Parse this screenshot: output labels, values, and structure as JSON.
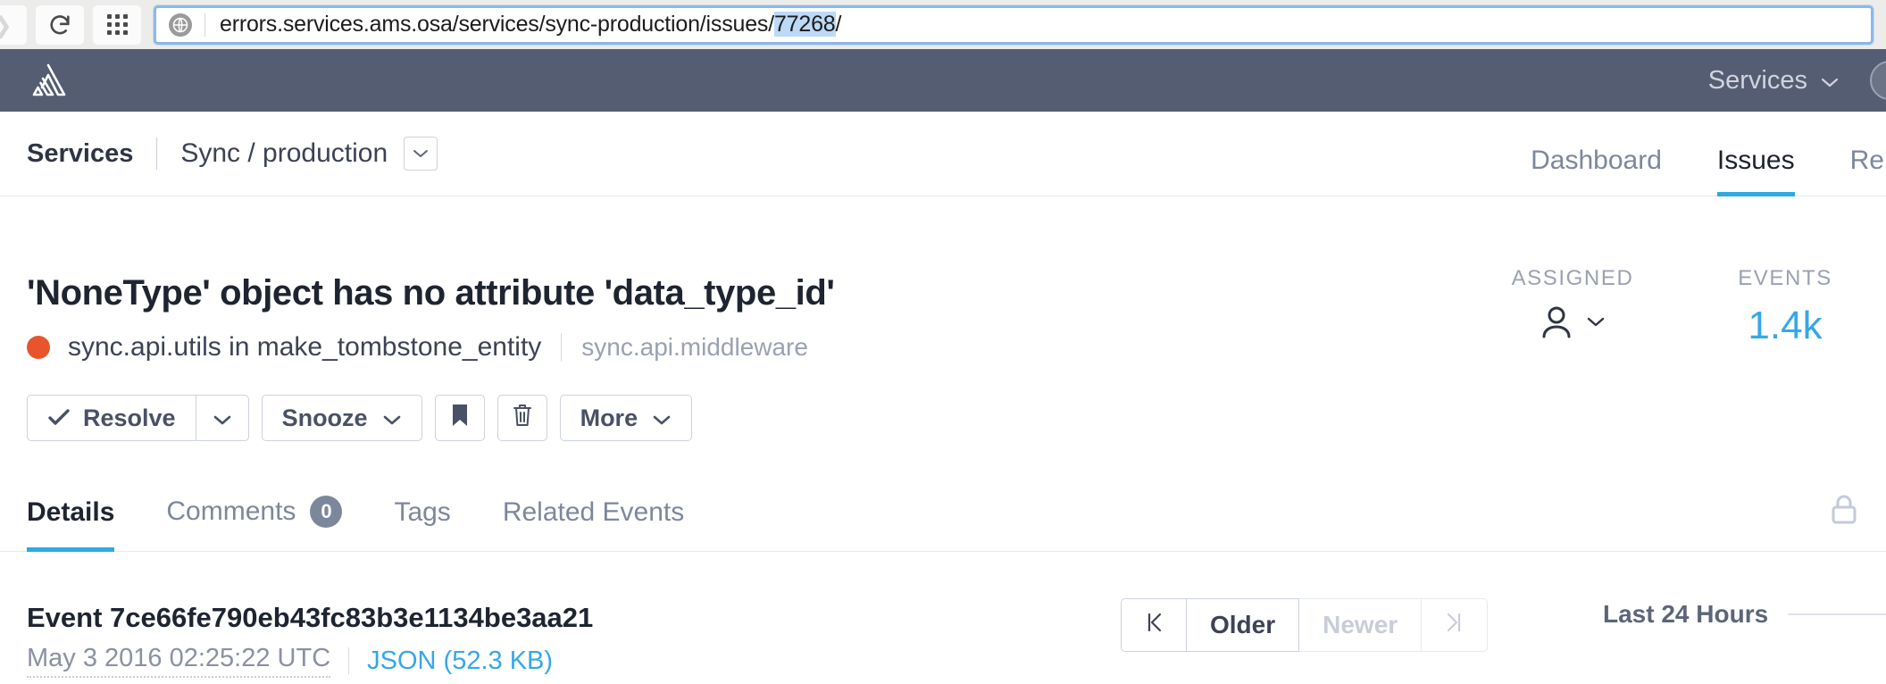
{
  "browser": {
    "forward_icon": "forward-arrow-icon",
    "reload_icon": "reload-icon",
    "apps_icon": "apps-grid-icon",
    "site_icon": "globe-icon",
    "url_prefix": "errors.services.ams.osa/services/sync-production/issues/",
    "url_highlight": "77268",
    "url_suffix": "/"
  },
  "app_header": {
    "logo": "sentry-logo-icon",
    "services_label": "Services",
    "services_caret": "chevron-down-icon",
    "avatar": "user-avatar"
  },
  "subnav": {
    "org_label": "Services",
    "project_label": "Sync / production",
    "project_caret": "chevron-down-icon",
    "tabs": [
      {
        "label": "Dashboard",
        "active": false
      },
      {
        "label": "Issues",
        "active": true
      },
      {
        "label": "Relea",
        "active": false
      }
    ]
  },
  "issue": {
    "title": "'NoneType' object has no attribute 'data_type_id'",
    "level_color": "#e8552d",
    "culprit": "sync.api.utils in make_tombstone_entity",
    "module": "sync.api.middleware",
    "actions": {
      "resolve_label": "Resolve",
      "resolve_icon": "check-icon",
      "resolve_caret": "chevron-down-icon",
      "snooze_label": "Snooze",
      "snooze_caret": "chevron-down-icon",
      "bookmark_icon": "bookmark-icon",
      "delete_icon": "trash-icon",
      "more_label": "More",
      "more_caret": "chevron-down-icon"
    },
    "stats": {
      "assigned_label": "ASSIGNED",
      "assigned_icon": "user-icon",
      "assigned_caret": "chevron-down-icon",
      "events_label": "EVENTS",
      "events_value": "1.4k",
      "events_color": "#36a7e8"
    }
  },
  "content_tabs": {
    "items": [
      {
        "label": "Details",
        "active": true,
        "badge": null
      },
      {
        "label": "Comments",
        "active": false,
        "badge": "0"
      },
      {
        "label": "Tags",
        "active": false,
        "badge": null
      },
      {
        "label": "Related Events",
        "active": false,
        "badge": null
      }
    ],
    "lock_icon": "lock-icon"
  },
  "event": {
    "id_label": "Event 7ce66fe790eb43fc83b3e1134be3aa21",
    "timestamp": "May 3 2016 02:25:22 UTC",
    "json_link": "JSON (52.3 KB)",
    "pager": {
      "first_icon": "first-page-icon",
      "older_label": "Older",
      "newer_label": "Newer",
      "last_icon": "last-page-icon"
    },
    "chart_range_label": "Last 24 Hours"
  }
}
